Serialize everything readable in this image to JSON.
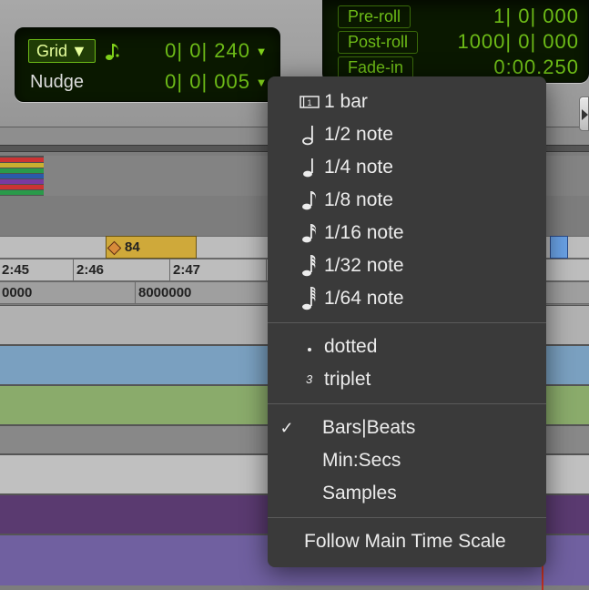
{
  "grid_panel": {
    "grid_label": "Grid",
    "grid_value": "0| 0| 240",
    "nudge_label": "Nudge",
    "nudge_value": "0| 0| 005"
  },
  "roll_panel": {
    "preroll_label": "Pre-roll",
    "preroll_value": "1| 0| 000",
    "postroll_label": "Post-roll",
    "postroll_value": "1000| 0| 000",
    "fadein_label": "Fade-in",
    "fadein_value": "0:00.250"
  },
  "ruler": {
    "bars": {
      "marker": "84"
    },
    "minsec": {
      "t1": "2:45",
      "t2": "2:46",
      "t3": "2:47"
    },
    "samples": {
      "t1": "0000",
      "t2": "8000000"
    }
  },
  "menu": {
    "notes": [
      {
        "label": "1 bar"
      },
      {
        "label": "1/2 note"
      },
      {
        "label": "1/4 note"
      },
      {
        "label": "1/8 note"
      },
      {
        "label": "1/16 note"
      },
      {
        "label": "1/32 note"
      },
      {
        "label": "1/64 note"
      }
    ],
    "dotted": "dotted",
    "triplet": "triplet",
    "time_bases": {
      "bars": "Bars|Beats",
      "minsec": "Min:Secs",
      "samples": "Samples"
    },
    "selected_time_base": "bars",
    "follow": "Follow Main Time Scale"
  }
}
